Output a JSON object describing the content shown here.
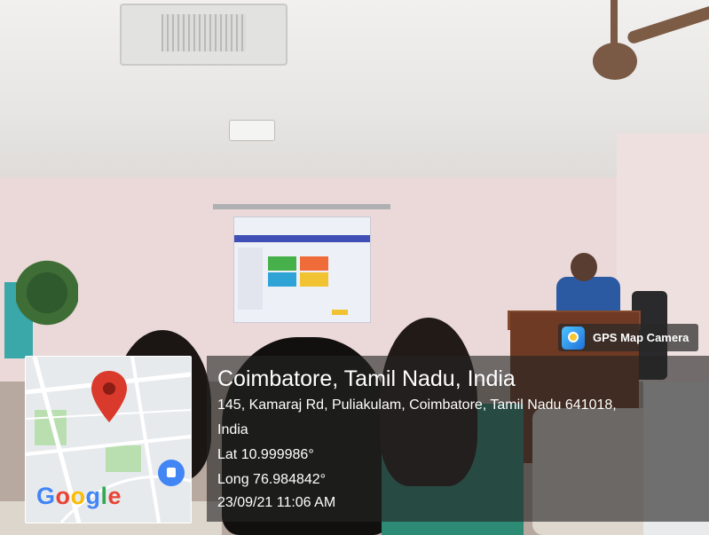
{
  "badge": {
    "label": "GPS Map Camera",
    "icon": "gps-map-camera-icon"
  },
  "map": {
    "brand": "Google",
    "pin_icon": "location-pin-icon",
    "bag_icon": "shopping-bag-icon"
  },
  "location": {
    "title": "Coimbatore, Tamil Nadu, India",
    "address_line1": "145, Kamaraj Rd, Puliakulam, Coimbatore, Tamil Nadu 641018,",
    "address_line2": "India",
    "lat": "Lat 10.999986°",
    "long": "Long 76.984842°",
    "datetime": "23/09/21 11:06 AM"
  },
  "colors": {
    "pin_red": "#d93a2b",
    "google_blue": "#4285f4",
    "google_red": "#ea4335",
    "google_yellow": "#fbbc05",
    "google_green": "#34a853"
  }
}
